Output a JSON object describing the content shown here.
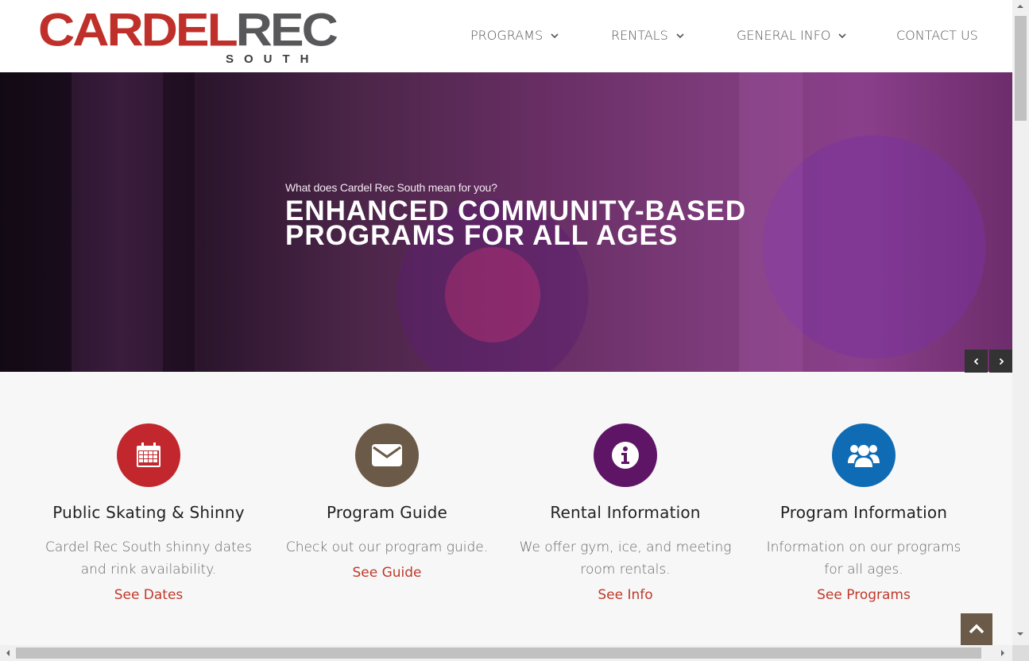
{
  "header": {
    "logo": {
      "part1": "CARDEL",
      "part2": "REC",
      "sub": "SOUTH"
    },
    "nav": [
      {
        "label": "PROGRAMS",
        "has_dropdown": true
      },
      {
        "label": "RENTALS",
        "has_dropdown": true
      },
      {
        "label": "GENERAL INFO",
        "has_dropdown": true
      },
      {
        "label": "CONTACT US",
        "has_dropdown": false
      }
    ]
  },
  "hero": {
    "subtitle": "What does Cardel Rec South mean for you?",
    "title": "ENHANCED COMMUNITY-BASED\nPROGRAMS FOR ALL AGES",
    "prev_icon": "chevron-left-icon",
    "next_icon": "chevron-right-icon"
  },
  "features": [
    {
      "icon": "calendar-icon",
      "color": "#c1272d",
      "title": "Public Skating & Shinny",
      "text": "Cardel Rec South shinny dates and rink availability.",
      "link": "See Dates"
    },
    {
      "icon": "envelope-icon",
      "color": "#6b5a47",
      "title": "Program Guide",
      "text": "Check out our program guide.",
      "link": "See Guide"
    },
    {
      "icon": "info-icon",
      "color": "#5e1566",
      "title": "Rental Information",
      "text": "We offer gym, ice, and meeting room rentals.",
      "link": "See Info"
    },
    {
      "icon": "users-icon",
      "color": "#0f6bb3",
      "title": "Program Information",
      "text": "Information on our programs for all ages.",
      "link": "See Programs"
    }
  ],
  "back_to_top_icon": "chevron-up-icon"
}
